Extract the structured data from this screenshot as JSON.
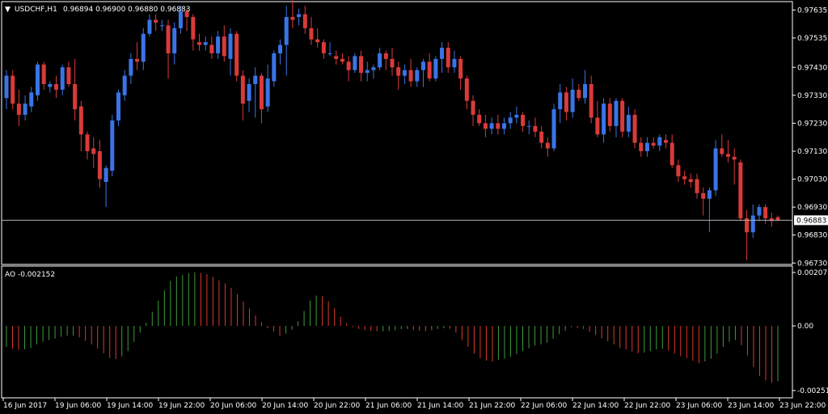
{
  "header": {
    "symbol": "USDCHF,H1",
    "ohlc": "0.96894 0.96900 0.96880 0.96883"
  },
  "indicator": {
    "label": "AO -0.002152"
  },
  "colors": {
    "background": "#000000",
    "bull": "#3a74e6",
    "bear": "#d93a3a",
    "ao_up": "#3c9b3c",
    "ao_down": "#d93a2a",
    "frame": "#ffffff"
  },
  "chart_data": [
    {
      "type": "candlestick",
      "title": "",
      "y_ticks": [
        "0.97635",
        "0.97535",
        "0.97430",
        "0.97330",
        "0.97230",
        "0.97130",
        "0.97030",
        "0.96930",
        "0.96830",
        "0.96730"
      ],
      "ylim": [
        0.96725,
        0.97665
      ],
      "current_price": "0.96883",
      "x_ticks": [
        "16 Jun 2017",
        "19 Jun 06:00",
        "19 Jun 14:00",
        "19 Jun 22:00",
        "20 Jun 06:00",
        "20 Jun 14:00",
        "20 Jun 22:00",
        "21 Jun 06:00",
        "21 Jun 14:00",
        "21 Jun 22:00",
        "22 Jun 06:00",
        "22 Jun 14:00",
        "22 Jun 22:00",
        "23 Jun 06:00",
        "23 Jun 14:00",
        "23 Jun 22:00"
      ],
      "candles": [
        {
          "o": 0.9732,
          "h": 0.9742,
          "l": 0.9728,
          "c": 0.974
        },
        {
          "o": 0.974,
          "h": 0.9742,
          "l": 0.9728,
          "c": 0.973
        },
        {
          "o": 0.973,
          "h": 0.9735,
          "l": 0.9722,
          "c": 0.9726
        },
        {
          "o": 0.9726,
          "h": 0.9733,
          "l": 0.9724,
          "c": 0.973
        },
        {
          "o": 0.9729,
          "h": 0.9736,
          "l": 0.9727,
          "c": 0.9734
        },
        {
          "o": 0.9733,
          "h": 0.9745,
          "l": 0.9731,
          "c": 0.9744
        },
        {
          "o": 0.9744,
          "h": 0.9745,
          "l": 0.9735,
          "c": 0.9737
        },
        {
          "o": 0.9736,
          "h": 0.9738,
          "l": 0.9734,
          "c": 0.9737
        },
        {
          "o": 0.9737,
          "h": 0.974,
          "l": 0.9732,
          "c": 0.9735
        },
        {
          "o": 0.9735,
          "h": 0.9744,
          "l": 0.9733,
          "c": 0.9743
        },
        {
          "o": 0.9743,
          "h": 0.9745,
          "l": 0.9736,
          "c": 0.9737
        },
        {
          "o": 0.9737,
          "h": 0.9746,
          "l": 0.9724,
          "c": 0.9728
        },
        {
          "o": 0.9729,
          "h": 0.9731,
          "l": 0.9713,
          "c": 0.9719
        },
        {
          "o": 0.9719,
          "h": 0.972,
          "l": 0.971,
          "c": 0.9713
        },
        {
          "o": 0.9714,
          "h": 0.9718,
          "l": 0.9707,
          "c": 0.9712
        },
        {
          "o": 0.9713,
          "h": 0.9717,
          "l": 0.97,
          "c": 0.9703
        },
        {
          "o": 0.9702,
          "h": 0.9708,
          "l": 0.9693,
          "c": 0.9707
        },
        {
          "o": 0.9706,
          "h": 0.9726,
          "l": 0.9704,
          "c": 0.9724
        },
        {
          "o": 0.9724,
          "h": 0.9735,
          "l": 0.9722,
          "c": 0.9734
        },
        {
          "o": 0.9733,
          "h": 0.9742,
          "l": 0.9731,
          "c": 0.974
        },
        {
          "o": 0.974,
          "h": 0.9748,
          "l": 0.9737,
          "c": 0.9746
        },
        {
          "o": 0.9746,
          "h": 0.9752,
          "l": 0.9742,
          "c": 0.9745
        },
        {
          "o": 0.9745,
          "h": 0.9757,
          "l": 0.9742,
          "c": 0.9755
        },
        {
          "o": 0.9755,
          "h": 0.9762,
          "l": 0.9754,
          "c": 0.976
        },
        {
          "o": 0.976,
          "h": 0.9762,
          "l": 0.9756,
          "c": 0.9759
        },
        {
          "o": 0.9758,
          "h": 0.976,
          "l": 0.9756,
          "c": 0.9758
        },
        {
          "o": 0.9758,
          "h": 0.976,
          "l": 0.9739,
          "c": 0.9748
        },
        {
          "o": 0.9748,
          "h": 0.9759,
          "l": 0.9744,
          "c": 0.9757
        },
        {
          "o": 0.9757,
          "h": 0.9765,
          "l": 0.9755,
          "c": 0.9763
        },
        {
          "o": 0.9763,
          "h": 0.9764,
          "l": 0.9756,
          "c": 0.9761
        },
        {
          "o": 0.9761,
          "h": 0.9762,
          "l": 0.9749,
          "c": 0.9753
        },
        {
          "o": 0.9752,
          "h": 0.9755,
          "l": 0.9749,
          "c": 0.9751
        },
        {
          "o": 0.9751,
          "h": 0.9754,
          "l": 0.9749,
          "c": 0.9752
        },
        {
          "o": 0.9751,
          "h": 0.9754,
          "l": 0.9746,
          "c": 0.9748
        },
        {
          "o": 0.9748,
          "h": 0.9756,
          "l": 0.9746,
          "c": 0.9754
        },
        {
          "o": 0.9754,
          "h": 0.9758,
          "l": 0.9745,
          "c": 0.9747
        },
        {
          "o": 0.9746,
          "h": 0.9757,
          "l": 0.974,
          "c": 0.9755
        },
        {
          "o": 0.9755,
          "h": 0.9756,
          "l": 0.9738,
          "c": 0.974
        },
        {
          "o": 0.974,
          "h": 0.9742,
          "l": 0.9724,
          "c": 0.973
        },
        {
          "o": 0.9731,
          "h": 0.9739,
          "l": 0.9727,
          "c": 0.9737
        },
        {
          "o": 0.9737,
          "h": 0.9743,
          "l": 0.9725,
          "c": 0.974
        },
        {
          "o": 0.974,
          "h": 0.9741,
          "l": 0.9723,
          "c": 0.9728
        },
        {
          "o": 0.9729,
          "h": 0.9744,
          "l": 0.9727,
          "c": 0.9739
        },
        {
          "o": 0.9738,
          "h": 0.9749,
          "l": 0.9736,
          "c": 0.9748
        },
        {
          "o": 0.9748,
          "h": 0.9753,
          "l": 0.9744,
          "c": 0.9751
        },
        {
          "o": 0.9751,
          "h": 0.9765,
          "l": 0.974,
          "c": 0.9761
        },
        {
          "o": 0.9761,
          "h": 0.9769,
          "l": 0.9757,
          "c": 0.976
        },
        {
          "o": 0.9761,
          "h": 0.9764,
          "l": 0.9758,
          "c": 0.9762
        },
        {
          "o": 0.9762,
          "h": 0.9765,
          "l": 0.9755,
          "c": 0.9757
        },
        {
          "o": 0.9757,
          "h": 0.9761,
          "l": 0.9751,
          "c": 0.9753
        },
        {
          "o": 0.9753,
          "h": 0.9757,
          "l": 0.975,
          "c": 0.9752
        },
        {
          "o": 0.9752,
          "h": 0.9753,
          "l": 0.9746,
          "c": 0.9748
        },
        {
          "o": 0.9748,
          "h": 0.9752,
          "l": 0.9747,
          "c": 0.9748
        },
        {
          "o": 0.9747,
          "h": 0.9749,
          "l": 0.9744,
          "c": 0.9746
        },
        {
          "o": 0.9746,
          "h": 0.9748,
          "l": 0.9744,
          "c": 0.9745
        },
        {
          "o": 0.9745,
          "h": 0.9747,
          "l": 0.9738,
          "c": 0.9742
        },
        {
          "o": 0.9742,
          "h": 0.9748,
          "l": 0.9741,
          "c": 0.9747
        },
        {
          "o": 0.9747,
          "h": 0.9749,
          "l": 0.9738,
          "c": 0.9741
        },
        {
          "o": 0.9741,
          "h": 0.9745,
          "l": 0.9738,
          "c": 0.9742
        },
        {
          "o": 0.9742,
          "h": 0.9744,
          "l": 0.9739,
          "c": 0.9743
        },
        {
          "o": 0.9743,
          "h": 0.975,
          "l": 0.9742,
          "c": 0.9748
        },
        {
          "o": 0.9748,
          "h": 0.9749,
          "l": 0.9742,
          "c": 0.9746
        },
        {
          "o": 0.9746,
          "h": 0.975,
          "l": 0.974,
          "c": 0.9743
        },
        {
          "o": 0.9743,
          "h": 0.9745,
          "l": 0.9735,
          "c": 0.974
        },
        {
          "o": 0.974,
          "h": 0.9744,
          "l": 0.9737,
          "c": 0.9742
        },
        {
          "o": 0.9742,
          "h": 0.9746,
          "l": 0.9736,
          "c": 0.9738
        },
        {
          "o": 0.9738,
          "h": 0.9743,
          "l": 0.9736,
          "c": 0.9742
        },
        {
          "o": 0.9742,
          "h": 0.9746,
          "l": 0.9736,
          "c": 0.9745
        },
        {
          "o": 0.9745,
          "h": 0.9748,
          "l": 0.9738,
          "c": 0.9739
        },
        {
          "o": 0.9739,
          "h": 0.9747,
          "l": 0.9738,
          "c": 0.9746
        },
        {
          "o": 0.9746,
          "h": 0.9752,
          "l": 0.9741,
          "c": 0.975
        },
        {
          "o": 0.975,
          "h": 0.9752,
          "l": 0.9741,
          "c": 0.9743
        },
        {
          "o": 0.9743,
          "h": 0.9749,
          "l": 0.9741,
          "c": 0.9746
        },
        {
          "o": 0.9746,
          "h": 0.9747,
          "l": 0.9735,
          "c": 0.9739
        },
        {
          "o": 0.9739,
          "h": 0.974,
          "l": 0.9728,
          "c": 0.9731
        },
        {
          "o": 0.9731,
          "h": 0.9733,
          "l": 0.9722,
          "c": 0.9726
        },
        {
          "o": 0.9726,
          "h": 0.9728,
          "l": 0.9722,
          "c": 0.9723
        },
        {
          "o": 0.9723,
          "h": 0.9726,
          "l": 0.9718,
          "c": 0.9721
        },
        {
          "o": 0.9721,
          "h": 0.9725,
          "l": 0.9719,
          "c": 0.9723
        },
        {
          "o": 0.9723,
          "h": 0.9726,
          "l": 0.9719,
          "c": 0.9721
        },
        {
          "o": 0.9721,
          "h": 0.9725,
          "l": 0.9719,
          "c": 0.9723
        },
        {
          "o": 0.9723,
          "h": 0.9727,
          "l": 0.9721,
          "c": 0.9725
        },
        {
          "o": 0.9725,
          "h": 0.9729,
          "l": 0.9723,
          "c": 0.9726
        },
        {
          "o": 0.9726,
          "h": 0.9727,
          "l": 0.972,
          "c": 0.9722
        },
        {
          "o": 0.9722,
          "h": 0.9724,
          "l": 0.9719,
          "c": 0.9722
        },
        {
          "o": 0.9722,
          "h": 0.9725,
          "l": 0.9718,
          "c": 0.972
        },
        {
          "o": 0.972,
          "h": 0.9722,
          "l": 0.9714,
          "c": 0.9716
        },
        {
          "o": 0.9716,
          "h": 0.9718,
          "l": 0.9711,
          "c": 0.9714
        },
        {
          "o": 0.9714,
          "h": 0.973,
          "l": 0.9713,
          "c": 0.9728
        },
        {
          "o": 0.9728,
          "h": 0.9737,
          "l": 0.9723,
          "c": 0.9734
        },
        {
          "o": 0.9734,
          "h": 0.9736,
          "l": 0.9724,
          "c": 0.9727
        },
        {
          "o": 0.9727,
          "h": 0.9739,
          "l": 0.9725,
          "c": 0.9735
        },
        {
          "o": 0.9735,
          "h": 0.9737,
          "l": 0.9731,
          "c": 0.9732
        },
        {
          "o": 0.9732,
          "h": 0.9742,
          "l": 0.973,
          "c": 0.9737
        },
        {
          "o": 0.9737,
          "h": 0.974,
          "l": 0.9723,
          "c": 0.9725
        },
        {
          "o": 0.9725,
          "h": 0.9731,
          "l": 0.9718,
          "c": 0.9719
        },
        {
          "o": 0.9719,
          "h": 0.9732,
          "l": 0.9716,
          "c": 0.973
        },
        {
          "o": 0.973,
          "h": 0.9732,
          "l": 0.972,
          "c": 0.9722
        },
        {
          "o": 0.9722,
          "h": 0.9732,
          "l": 0.9718,
          "c": 0.9731
        },
        {
          "o": 0.9731,
          "h": 0.9732,
          "l": 0.9718,
          "c": 0.972
        },
        {
          "o": 0.972,
          "h": 0.9729,
          "l": 0.9718,
          "c": 0.9726
        },
        {
          "o": 0.9726,
          "h": 0.9728,
          "l": 0.9714,
          "c": 0.9716
        },
        {
          "o": 0.9716,
          "h": 0.9718,
          "l": 0.9711,
          "c": 0.9713
        },
        {
          "o": 0.9713,
          "h": 0.9718,
          "l": 0.9711,
          "c": 0.9716
        },
        {
          "o": 0.9716,
          "h": 0.9718,
          "l": 0.9714,
          "c": 0.9715
        },
        {
          "o": 0.9715,
          "h": 0.9719,
          "l": 0.9713,
          "c": 0.9718
        },
        {
          "o": 0.9717,
          "h": 0.9719,
          "l": 0.9714,
          "c": 0.9716
        },
        {
          "o": 0.9716,
          "h": 0.9719,
          "l": 0.9707,
          "c": 0.9708
        },
        {
          "o": 0.9708,
          "h": 0.971,
          "l": 0.9702,
          "c": 0.9704
        },
        {
          "o": 0.9704,
          "h": 0.9706,
          "l": 0.9701,
          "c": 0.9703
        },
        {
          "o": 0.9703,
          "h": 0.9705,
          "l": 0.97,
          "c": 0.9702
        },
        {
          "o": 0.9703,
          "h": 0.9705,
          "l": 0.9696,
          "c": 0.9698
        },
        {
          "o": 0.9698,
          "h": 0.97,
          "l": 0.969,
          "c": 0.9696
        },
        {
          "o": 0.9696,
          "h": 0.97,
          "l": 0.9684,
          "c": 0.9699
        },
        {
          "o": 0.9699,
          "h": 0.9717,
          "l": 0.9697,
          "c": 0.9714
        },
        {
          "o": 0.9714,
          "h": 0.9719,
          "l": 0.9711,
          "c": 0.9712
        },
        {
          "o": 0.9712,
          "h": 0.9717,
          "l": 0.9709,
          "c": 0.9711
        },
        {
          "o": 0.9711,
          "h": 0.9714,
          "l": 0.9701,
          "c": 0.971
        },
        {
          "o": 0.9709,
          "h": 0.971,
          "l": 0.9688,
          "c": 0.9689
        },
        {
          "o": 0.9689,
          "h": 0.9692,
          "l": 0.9674,
          "c": 0.9684
        },
        {
          "o": 0.9684,
          "h": 0.9694,
          "l": 0.9682,
          "c": 0.969
        },
        {
          "o": 0.969,
          "h": 0.9694,
          "l": 0.9688,
          "c": 0.9693
        },
        {
          "o": 0.9693,
          "h": 0.9694,
          "l": 0.9687,
          "c": 0.9689
        },
        {
          "o": 0.9689,
          "h": 0.9691,
          "l": 0.9686,
          "c": 0.9688
        },
        {
          "o": 0.96894,
          "h": 0.969,
          "l": 0.9688,
          "c": 0.96883
        }
      ]
    },
    {
      "type": "bar",
      "title": "",
      "y_ticks": [
        "0.002076",
        "0.00",
        "-0.002514"
      ],
      "ylim": [
        -0.002514,
        0.002076
      ],
      "values": [
        -0.00081,
        -0.00088,
        -0.00093,
        -0.00091,
        -0.00086,
        -0.00072,
        -0.00062,
        -0.00055,
        -0.00049,
        -0.00042,
        -0.00038,
        -0.00038,
        -0.00045,
        -0.00058,
        -0.00072,
        -0.00088,
        -0.00106,
        -0.00124,
        -0.00129,
        -0.00118,
        -0.00098,
        -0.00062,
        -0.00026,
        0.00012,
        0.00055,
        0.00098,
        0.00138,
        0.00175,
        0.00192,
        0.00198,
        0.00205,
        0.00208,
        0.00206,
        0.00201,
        0.00191,
        0.00177,
        0.00165,
        0.00148,
        0.00124,
        0.00095,
        0.00068,
        0.0004,
        0.00014,
        -9e-05,
        -0.00022,
        -0.00038,
        -0.0003,
        -0.00015,
        0.00018,
        0.00058,
        0.00098,
        0.00118,
        0.00116,
        0.00096,
        0.00069,
        0.00036,
        9e-05,
        -5e-05,
        -0.00012,
        -0.00016,
        -0.00019,
        -0.00021,
        -0.00021,
        -0.00019,
        -0.00017,
        -0.00013,
        -0.00012,
        -0.00016,
        -0.00019,
        -0.00021,
        -0.00017,
        -0.00012,
        -9e-05,
        -0.00011,
        -0.00026,
        -0.00055,
        -0.00082,
        -0.00108,
        -0.00125,
        -0.00135,
        -0.00138,
        -0.00132,
        -0.00128,
        -0.0012,
        -0.00109,
        -0.00098,
        -0.00087,
        -0.00076,
        -0.00072,
        -0.00065,
        -0.00049,
        -0.00032,
        -0.00018,
        -5e-05,
        -8e-05,
        -0.00012,
        -0.00022,
        -0.00035,
        -0.00048,
        -0.0006,
        -0.00072,
        -0.00085,
        -0.00092,
        -0.00099,
        -0.00106,
        -0.00104,
        -0.00098,
        -0.00091,
        -0.00089,
        -0.00096,
        -0.00108,
        -0.00118,
        -0.00125,
        -0.00135,
        -0.00145,
        -0.00138,
        -0.00128,
        -0.00108,
        -0.00082,
        -0.00062,
        -0.00055,
        -0.00075,
        -0.00115,
        -0.0016,
        -0.00195,
        -0.00212,
        -0.00221,
        -0.00215
      ]
    }
  ]
}
